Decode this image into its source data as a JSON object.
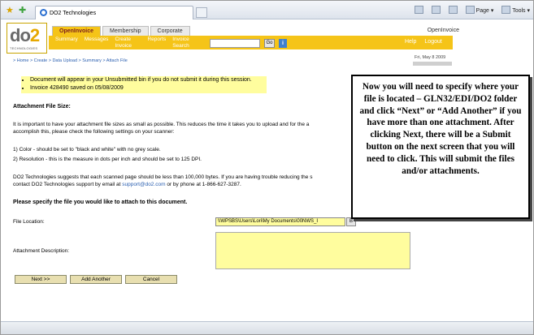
{
  "browser": {
    "tab_title": "DO2 Technologies",
    "toolbar": {
      "page_label": "Page",
      "tools_label": "Tools"
    }
  },
  "site": {
    "logo_text": "do2",
    "logo_sub": "TECHNOLOGIES",
    "nav_tabs": [
      "OpenInvoice",
      "Membership",
      "Corporate"
    ],
    "product_name": "OpenInvoice",
    "menu": [
      "Summary",
      "Messages",
      "Create Invoice",
      "Reports",
      "Invoice Search"
    ],
    "go_label": "Go",
    "help_label": "Help",
    "logout_label": "Logout"
  },
  "page": {
    "breadcrumb": "> Home > Create > Data Upload > Summary > Attach File",
    "date": "Fri, May 8 2009",
    "notices": [
      "Document will appear in your Unsubmitted bin if you do not submit it during this session.",
      "Invoice 428490 saved on 05/08/2009"
    ],
    "section_title": "Attachment File Size:",
    "para1_line1": "It is important to have your attachment file sizes as small as possible. This reduces the time it takes you to upload and for the a",
    "para1_line2": "accomplish this, please check the following settings on your scanner:",
    "item1": "1) Color - should be set to \"black and white\" with no grey scale.",
    "item2": "2) Resolution - this is the measure in dots per inch and should be set to 125 DPI.",
    "para2_line1": "DO2 Technologies suggests that each scanned page should be less than 100,000 bytes. If you are having trouble reducing the s",
    "para2_line2_pre": "contact DO2 Technologies support by email at ",
    "support_email": "support@do2.com",
    "para2_line2_post": " or by phone at 1-866-627-3287.",
    "specify_title": "Please specify the file you would like to attach to this document.",
    "file_location_label": "File Location:",
    "file_location_value": "\\\\WPSBS\\Users\\Lori\\My Documents\\00NWS_I",
    "browse_label": "B",
    "attachment_desc_label": "Attachment Description:",
    "buttons": {
      "next": "Next >>",
      "add_another": "Add Another",
      "cancel": "Cancel"
    }
  },
  "callout": {
    "text": "Now you will need to specify where your file is located – GLN32/EDI/DO2 folder and click “Next” or “Add Another” if you have more than one attachment. After clicking Next, there will be a Submit button on the next screen that you will need to click.  This will submit the files and/or attachments."
  }
}
